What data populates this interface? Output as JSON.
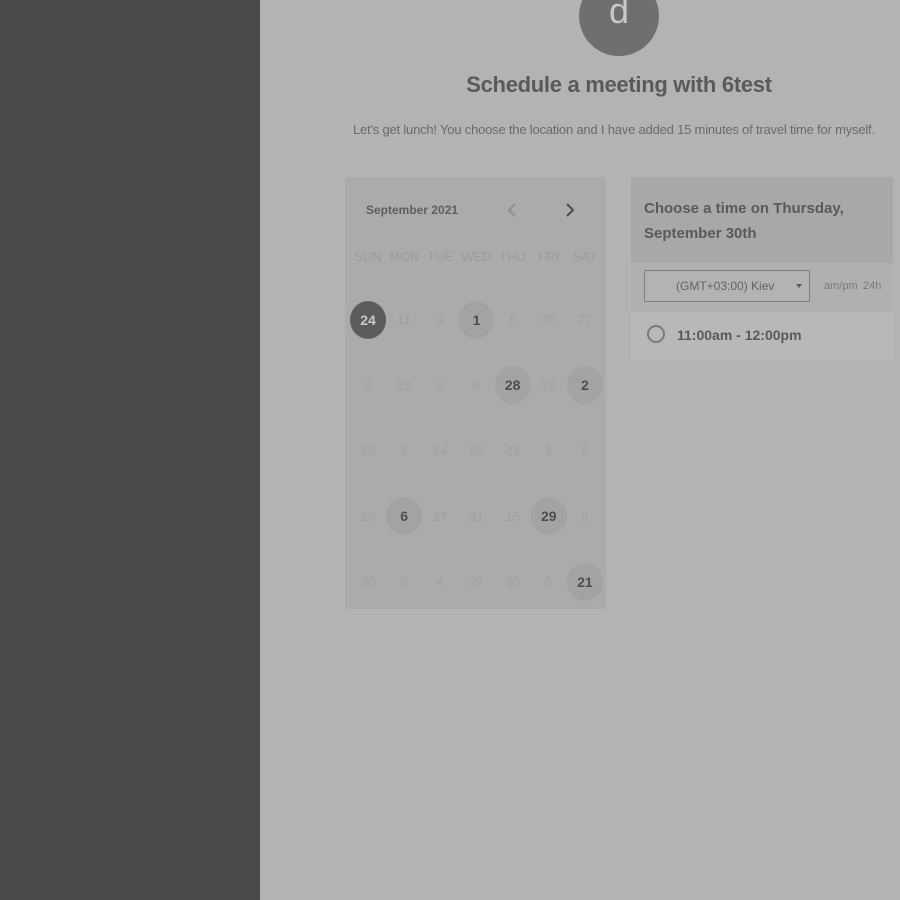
{
  "avatar": {
    "initial": "d"
  },
  "page": {
    "title": "Schedule a meeting with 6test",
    "subtitle": "Let's get lunch! You choose the location and I have added 15 minutes of travel time for myself."
  },
  "calendar": {
    "month_label": "September 2021",
    "prev_icon": "chevron-left-icon",
    "next_icon": "chevron-right-icon",
    "weekdays": [
      "SUN",
      "MON",
      "TUE",
      "WED",
      "THU",
      "FRI",
      "SAT"
    ],
    "weeks": [
      [
        {
          "label": "24",
          "state": "selected"
        },
        {
          "label": "11",
          "state": "disabled"
        },
        {
          "label": "4",
          "state": "disabled"
        },
        {
          "label": "1",
          "state": "available"
        },
        {
          "label": "6",
          "state": "disabled"
        },
        {
          "label": "25",
          "state": "disabled"
        },
        {
          "label": "27",
          "state": "disabled"
        }
      ],
      [
        {
          "label": "5",
          "state": "disabled"
        },
        {
          "label": "22",
          "state": "disabled"
        },
        {
          "label": "5",
          "state": "disabled"
        },
        {
          "label": "6",
          "state": "disabled"
        },
        {
          "label": "28",
          "state": "available"
        },
        {
          "label": "28",
          "state": "disabled"
        },
        {
          "label": "2",
          "state": "available"
        }
      ],
      [
        {
          "label": "28",
          "state": "disabled"
        },
        {
          "label": "6",
          "state": "disabled"
        },
        {
          "label": "24",
          "state": "disabled"
        },
        {
          "label": "26",
          "state": "disabled"
        },
        {
          "label": "22",
          "state": "disabled"
        },
        {
          "label": "1",
          "state": "disabled"
        },
        {
          "label": "2",
          "state": "disabled"
        }
      ],
      [
        {
          "label": "26",
          "state": "disabled"
        },
        {
          "label": "6",
          "state": "available"
        },
        {
          "label": "27",
          "state": "disabled"
        },
        {
          "label": "31",
          "state": "disabled"
        },
        {
          "label": "15",
          "state": "disabled"
        },
        {
          "label": "29",
          "state": "available"
        },
        {
          "label": "8",
          "state": "disabled"
        }
      ],
      [
        {
          "label": "30",
          "state": "disabled"
        },
        {
          "label": "9",
          "state": "disabled"
        },
        {
          "label": "4",
          "state": "disabled"
        },
        {
          "label": "27",
          "state": "disabled"
        },
        {
          "label": "20",
          "state": "disabled"
        },
        {
          "label": "5",
          "state": "disabled"
        },
        {
          "label": "21",
          "state": "available"
        }
      ]
    ]
  },
  "time_panel": {
    "heading": "Choose a time on Thursday, September 30th",
    "timezone": "(GMT+03:00) Kiev",
    "format_ampm": "am/pm",
    "format_24h": "24h",
    "slots": [
      {
        "label": "11:00am - 12:00pm"
      }
    ]
  },
  "colors": {
    "overlay_bg": "#b3b3b3",
    "sidebar_bg": "#4a4a4a",
    "selected_day": "#5c5c5c",
    "available_day": "#a3a3a3"
  }
}
